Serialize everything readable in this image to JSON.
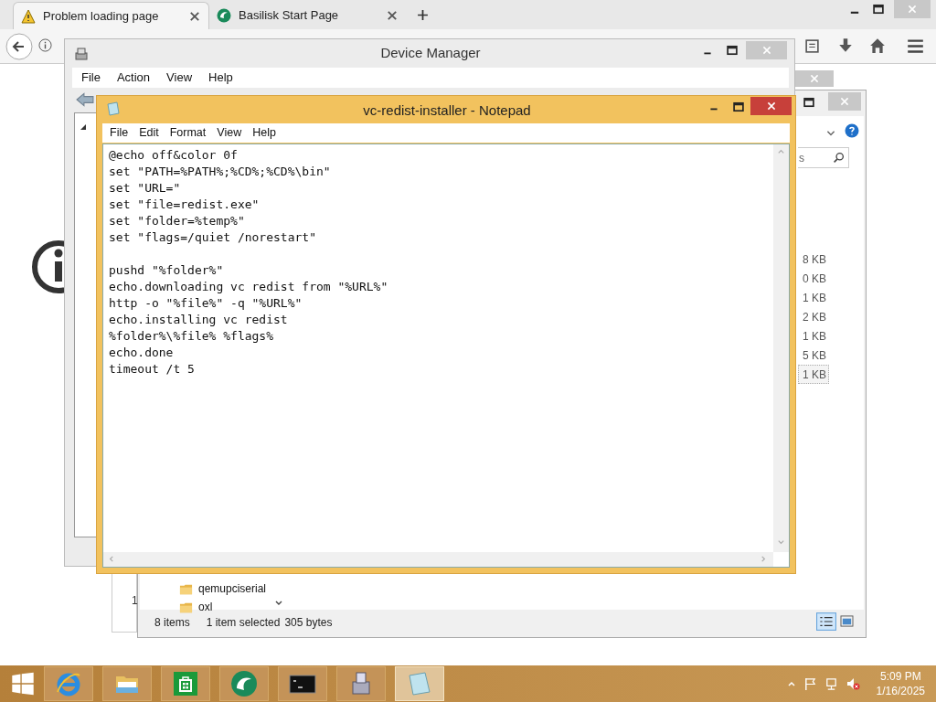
{
  "browser": {
    "tabs": [
      {
        "label": "Problem loading page",
        "selected": true,
        "kind": "warning"
      },
      {
        "label": "Basilisk Start Page",
        "selected": false,
        "kind": "basilisk"
      }
    ]
  },
  "device_manager": {
    "title": "Device Manager",
    "menu": [
      "File",
      "Action",
      "View",
      "Help"
    ]
  },
  "explorer": {
    "search": {
      "value": "s"
    },
    "sizes": [
      {
        "text": "8 KB",
        "selected": false
      },
      {
        "text": "0 KB",
        "selected": false
      },
      {
        "text": "1 KB",
        "selected": false
      },
      {
        "text": "2 KB",
        "selected": false
      },
      {
        "text": "1 KB",
        "selected": false
      },
      {
        "text": "5 KB",
        "selected": false
      },
      {
        "text": "1 KB",
        "selected": true
      }
    ],
    "folders": [
      "qemupciserial",
      "oxl"
    ],
    "status": {
      "count": "8 items",
      "selection": "1 item selected",
      "size": "305 bytes"
    }
  },
  "side_fragment": "1",
  "notepad": {
    "title": "vc-redist-installer - Notepad",
    "menu": [
      "File",
      "Edit",
      "Format",
      "View",
      "Help"
    ],
    "blocks": [
      [
        "@echo off&color 0f",
        "set \"PATH=%PATH%;%CD%;%CD%\\bin\"",
        "set \"URL=\"",
        "set \"file=redist.exe\"",
        "set \"folder=%temp%\"",
        "set \"flags=/quiet /norestart\""
      ],
      [
        "pushd \"%folder%\"",
        "echo.downloading vc redist from \"%URL%\"",
        "http -o \"%file%\" -q \"%URL%\"",
        "echo.installing vc redist",
        "%folder%\\%file% %flags%",
        "echo.done",
        "timeout /t 5"
      ]
    ]
  },
  "taskbar": {
    "apps": [
      {
        "kind": "ie",
        "active": false
      },
      {
        "kind": "explorer",
        "active": false
      },
      {
        "kind": "store",
        "active": false
      },
      {
        "kind": "basilisk",
        "active": false
      },
      {
        "kind": "cmd",
        "active": false
      },
      {
        "kind": "devmgr",
        "active": false
      },
      {
        "kind": "notepad",
        "active": true
      }
    ],
    "time": "5:09 PM",
    "date": "1/16/2025"
  }
}
